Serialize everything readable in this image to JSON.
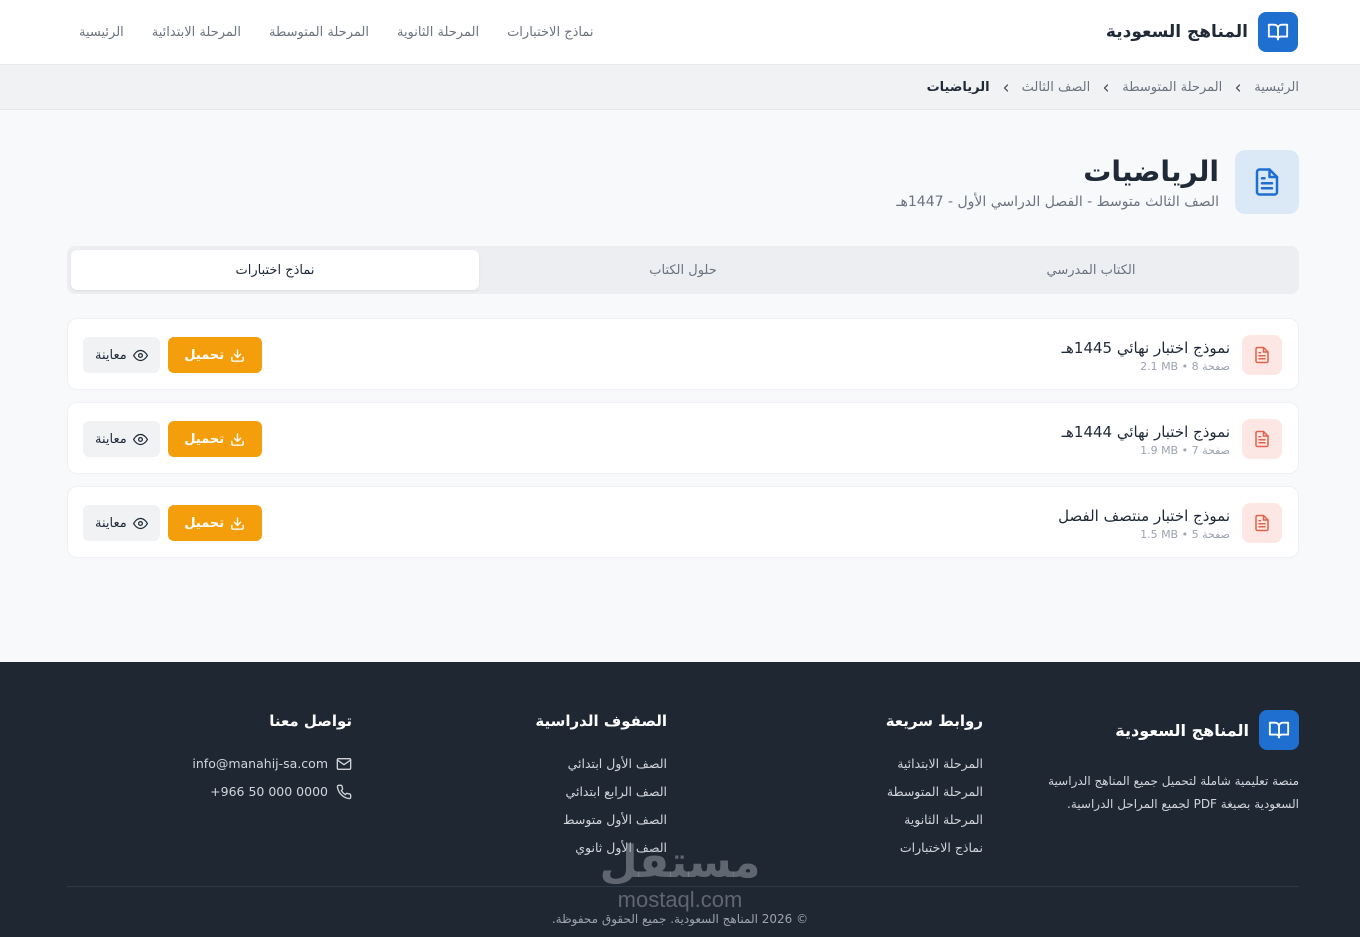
{
  "colors": {
    "primary": "#1e6fd0",
    "accent": "#f59e0b",
    "footer_bg": "#1f2733"
  },
  "header": {
    "brand": "المناهج السعودية",
    "nav": [
      "الرئيسية",
      "المرحلة الابتدائية",
      "المرحلة المتوسطة",
      "المرحلة الثانوية",
      "نماذج الاختبارات"
    ]
  },
  "breadcrumb": [
    "الرئيسية",
    "المرحلة المتوسطة",
    "الصف الثالث",
    "الرياضيات"
  ],
  "page": {
    "title": "الرياضيات",
    "subtitle": "الصف الثالث متوسط - الفصل الدراسي الأول - 1447هـ"
  },
  "tabs": [
    {
      "label": "الكتاب المدرسي",
      "active": false
    },
    {
      "label": "حلول الكتاب",
      "active": false
    },
    {
      "label": "نماذج اختبارات",
      "active": true
    }
  ],
  "files": [
    {
      "title": "نموذج اختبار نهائي 1445هـ",
      "meta": "2.1 MB • 8 صفحة"
    },
    {
      "title": "نموذج اختبار نهائي 1444هـ",
      "meta": "1.9 MB • 7 صفحة"
    },
    {
      "title": "نموذج اختبار منتصف الفصل",
      "meta": "1.5 MB • 5 صفحة"
    }
  ],
  "actions": {
    "preview": "معاينة",
    "download": "تحميل"
  },
  "footer": {
    "brand": "المناهج السعودية",
    "description": "منصة تعليمية شاملة لتحميل جميع المناهج الدراسية السعودية بصيغة PDF لجميع المراحل الدراسية.",
    "quick_links_title": "روابط سريعة",
    "quick_links": [
      "المرحلة الابتدائية",
      "المرحلة المتوسطة",
      "المرحلة الثانوية",
      "نماذج الاختبارات"
    ],
    "grades_title": "الصفوف الدراسية",
    "grades": [
      "الصف الأول ابتدائي",
      "الصف الرابع ابتدائي",
      "الصف الأول متوسط",
      "الصف الأول ثانوي"
    ],
    "contact_title": "تواصل معنا",
    "email": "info@manahij-sa.com",
    "phone": "+966 50 000 0000",
    "copyright": "© 2026 المناهج السعودية. جميع الحقوق محفوظة."
  },
  "watermark": {
    "arabic": "مستقل",
    "latin": "mostaql.com"
  }
}
